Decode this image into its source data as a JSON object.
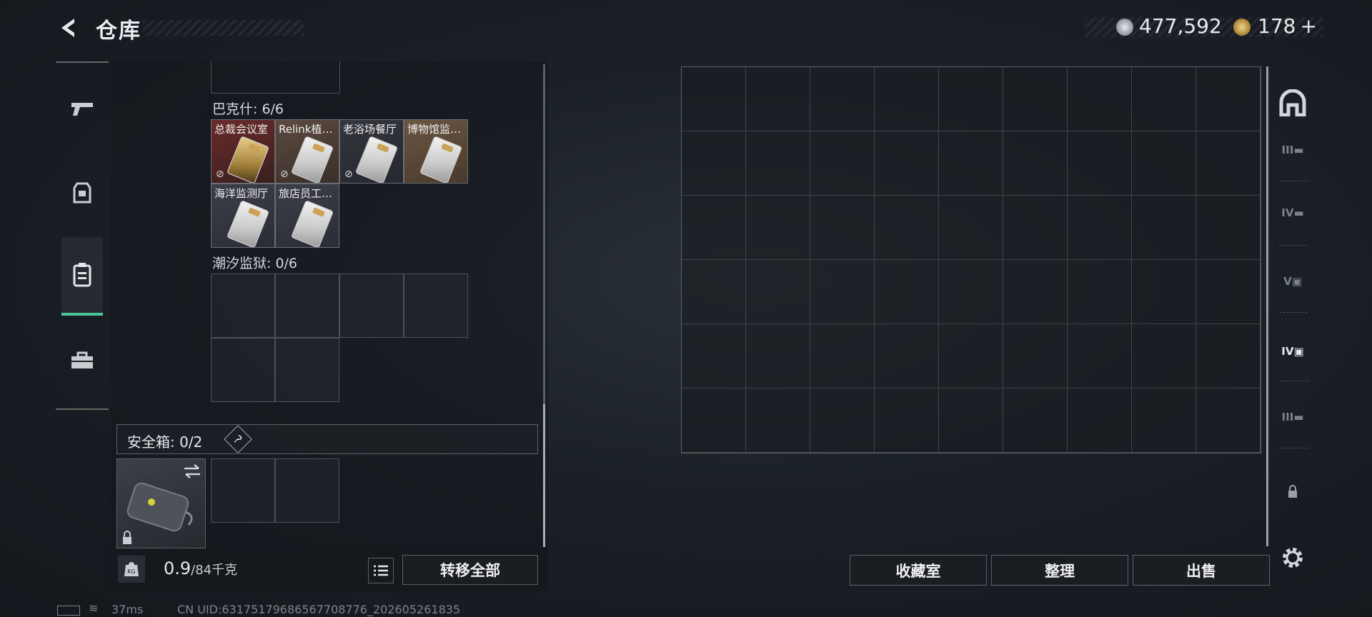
{
  "header": {
    "title": "仓库"
  },
  "currency": [
    {
      "value": "477,592",
      "icon": "silver-coin-icon",
      "color": "#b8bcc2"
    },
    {
      "value": "178",
      "icon": "gold-coin-icon",
      "color": "#c9a553",
      "add": "+"
    }
  ],
  "groups": {
    "bakeshi": {
      "label": "巴克什: 6/6",
      "cards": [
        "总裁会议室",
        "Relink植…",
        "老浴场餐厅",
        "博物馆监…",
        "海洋监测厅",
        "旅店员工…"
      ]
    },
    "chaoxi": {
      "label": "潮汐监狱: 0/6"
    }
  },
  "safebox": {
    "label": "安全箱: 0/2",
    "help": "?"
  },
  "weight": {
    "value": "0.9",
    "capacity": "/84千克",
    "kg": "KG"
  },
  "buttons": {
    "transfer_all": "转移全部",
    "collection": "收藏室",
    "sort": "整理",
    "sell": "出售"
  },
  "side_tabs": [
    "III",
    "IV",
    "V",
    "IV",
    "III"
  ],
  "status": {
    "ping": "37ms",
    "uid": "CN UID:631751796865677087​76_202605261835"
  }
}
